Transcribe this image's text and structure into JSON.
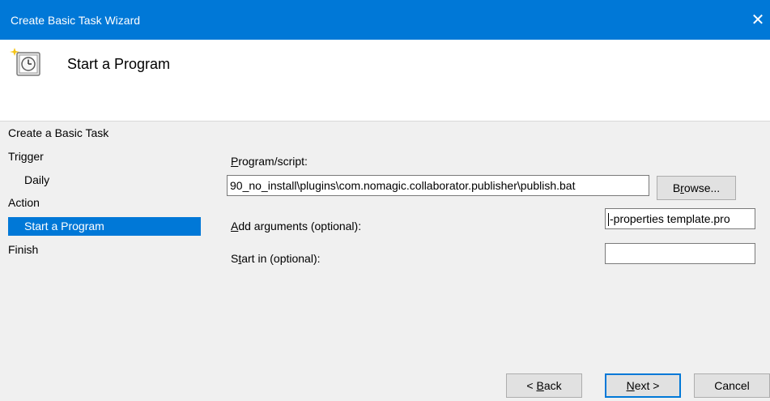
{
  "window": {
    "title": "Create Basic Task Wizard",
    "close_glyph": "✕"
  },
  "header": {
    "icon": "scheduled-task-clock-icon",
    "title": "Start a Program"
  },
  "nav": {
    "items": [
      {
        "label": "Create a Basic Task",
        "indent": false,
        "selected": false
      },
      {
        "label": "Trigger",
        "indent": false,
        "selected": false
      },
      {
        "label": "Daily",
        "indent": true,
        "selected": false
      },
      {
        "label": "Action",
        "indent": false,
        "selected": false
      },
      {
        "label": "Start a Program",
        "indent": true,
        "selected": true
      },
      {
        "label": "Finish",
        "indent": false,
        "selected": false
      }
    ]
  },
  "form": {
    "program_script": {
      "label_accel": "P",
      "label_rest": "rogram/script:",
      "value": "90_no_install\\plugins\\com.nomagic.collaborator.publisher\\publish.bat"
    },
    "browse": {
      "label_pre": "B",
      "label_accel": "r",
      "label_rest": "owse..."
    },
    "arguments": {
      "label_accel": "A",
      "label_rest": "dd arguments (optional):",
      "value": "-properties template.pro"
    },
    "start_in": {
      "label_pre": "S",
      "label_accel": "t",
      "label_rest": "art in (optional):",
      "value": ""
    }
  },
  "footer": {
    "back": {
      "label_pre": "< ",
      "label_accel": "B",
      "label_rest": "ack"
    },
    "next": {
      "label_accel": "N",
      "label_rest": "ext >"
    },
    "cancel": {
      "label": "Cancel"
    }
  },
  "colors": {
    "accent": "#0078d7",
    "window_bg": "#f0f0f0",
    "header_bg": "#ffffff"
  }
}
